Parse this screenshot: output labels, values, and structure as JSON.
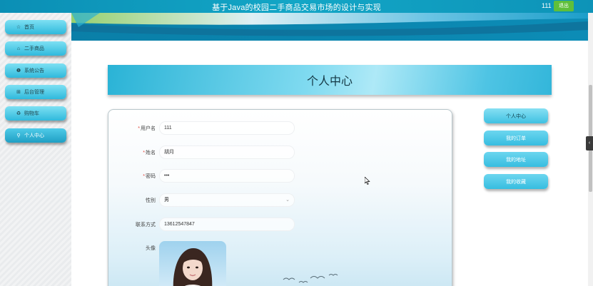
{
  "header": {
    "title": "基于Java的校园二手商品交易市场的设计与实现",
    "user": "111",
    "logout_label": "退出"
  },
  "sidebar": {
    "items": [
      {
        "label": "首页",
        "icon": "star-icon"
      },
      {
        "label": "二手商品",
        "icon": "home-icon"
      },
      {
        "label": "系统公告",
        "icon": "info-icon"
      },
      {
        "label": "后台管理",
        "icon": "admin-icon"
      },
      {
        "label": "购物车",
        "icon": "cart-icon"
      },
      {
        "label": "个人中心",
        "icon": "user-icon",
        "active": true
      }
    ]
  },
  "page": {
    "title": "个人中心"
  },
  "form": {
    "username_label": "用户名",
    "username_value": "111",
    "name_label": "姓名",
    "name_value": "胡月",
    "password_label": "密码",
    "password_value": "•••",
    "gender_label": "性别",
    "gender_value": "男",
    "contact_label": "联系方式",
    "contact_value": "13612547847",
    "avatar_label": "头像"
  },
  "right_menu": {
    "items": [
      {
        "label": "个人中心",
        "active": true
      },
      {
        "label": "我的订单"
      },
      {
        "label": "我的地址"
      },
      {
        "label": "我的收藏"
      }
    ]
  },
  "colors": {
    "accent": "#13a6c6",
    "logout": "#5fbf3a",
    "required": "#e0463a"
  }
}
